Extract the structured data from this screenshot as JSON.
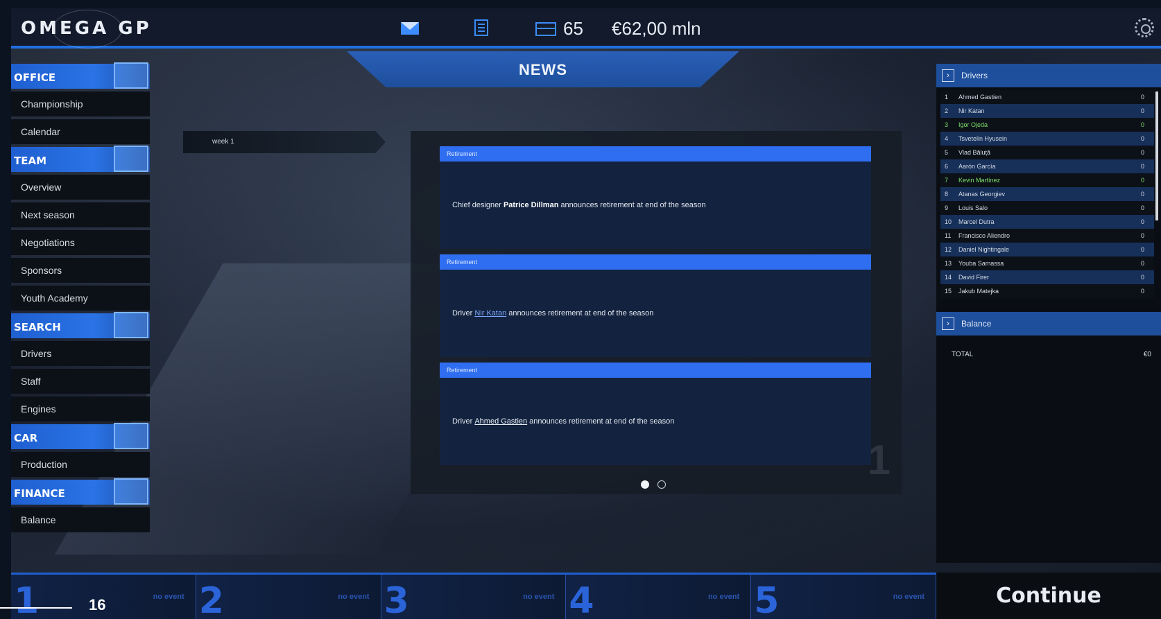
{
  "header": {
    "logo_text": "OMEGA GP",
    "count": "65",
    "money": "€62,00 mln"
  },
  "news_title": "NEWS",
  "sidebar": {
    "sections": [
      {
        "label": "OFFICE",
        "icon": "monitor-icon",
        "items": [
          "Championship",
          "Calendar"
        ]
      },
      {
        "label": "TEAM",
        "icon": "helmet-icon",
        "items": [
          "Overview",
          "Next season",
          "Negotiations",
          "Sponsors",
          "Youth Academy"
        ]
      },
      {
        "label": "SEARCH",
        "icon": "phone-icon",
        "items": [
          "Drivers",
          "Staff",
          "Engines"
        ]
      },
      {
        "label": "CAR",
        "icon": "car-icon",
        "items": [
          "Production"
        ]
      },
      {
        "label": "FINANCE",
        "icon": "bar-chart-icon",
        "items": [
          "Balance"
        ]
      }
    ]
  },
  "week_label": "week 1",
  "news": {
    "cards": [
      {
        "category": "Retirement",
        "pre": "Chief designer",
        "name": "Patrice Dillman",
        "post": "announces retirement at end of the season"
      },
      {
        "category": "Retirement",
        "pre": "Driver",
        "name": "Nir Katan",
        "post": "announces retirement at end of the season"
      },
      {
        "category": "Retirement",
        "pre": "Driver",
        "name": "Ahmed Gastien",
        "post": "announces retirement at end of the season"
      }
    ],
    "page_watermark": "1"
  },
  "drivers_panel": {
    "title": "Drivers",
    "rows": [
      {
        "pos": "1",
        "name": "Ahmed Gastien",
        "pts": "0"
      },
      {
        "pos": "2",
        "name": "Nir Katan",
        "pts": "0"
      },
      {
        "pos": "3",
        "name": "Igor Ojeda",
        "pts": "0"
      },
      {
        "pos": "4",
        "name": "Tsvetelin Hyusein",
        "pts": "0"
      },
      {
        "pos": "5",
        "name": "Vlad Băluță",
        "pts": "0"
      },
      {
        "pos": "6",
        "name": "Aarón García",
        "pts": "0"
      },
      {
        "pos": "7",
        "name": "Kevin Martínez",
        "pts": "0"
      },
      {
        "pos": "8",
        "name": "Atanas Georgiev",
        "pts": "0"
      },
      {
        "pos": "9",
        "name": "Louis Salo",
        "pts": "0"
      },
      {
        "pos": "10",
        "name": "Marcel Dutra",
        "pts": "0"
      },
      {
        "pos": "11",
        "name": "Francisco Aliendro",
        "pts": "0"
      },
      {
        "pos": "12",
        "name": "Daniel Nightingale",
        "pts": "0"
      },
      {
        "pos": "13",
        "name": "Youba Samassa",
        "pts": "0"
      },
      {
        "pos": "14",
        "name": "David Firer",
        "pts": "0"
      },
      {
        "pos": "15",
        "name": "Jakub Matejka",
        "pts": "0"
      }
    ],
    "highlighted_positions": [
      "3",
      "7"
    ]
  },
  "balance_panel": {
    "title": "Balance",
    "total_label": "TOTAL",
    "total_value": "€0"
  },
  "events": [
    {
      "num": "1",
      "text": "no event"
    },
    {
      "num": "2",
      "text": "no event"
    },
    {
      "num": "3",
      "text": "no event"
    },
    {
      "num": "4",
      "text": "no event"
    },
    {
      "num": "5",
      "text": "no event"
    }
  ],
  "continue_label": "Continue",
  "page_number": "16",
  "colors": {
    "accent": "#2f6ef0",
    "highlight_driver": "#7ee06a"
  }
}
